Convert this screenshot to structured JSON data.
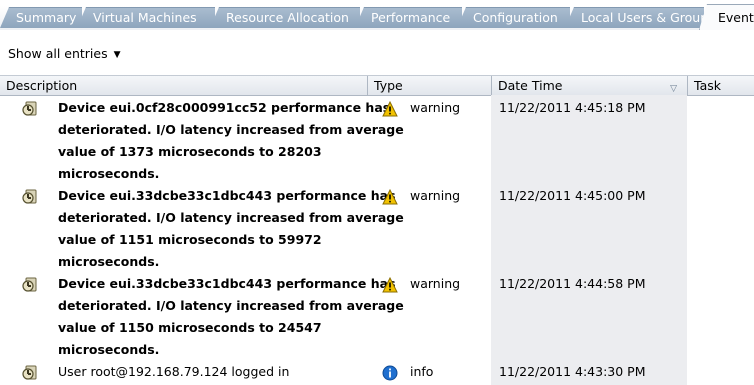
{
  "tabs": [
    {
      "label": "Summary"
    },
    {
      "label": "Virtual Machines"
    },
    {
      "label": "Resource Allocation"
    },
    {
      "label": "Performance"
    },
    {
      "label": "Configuration"
    },
    {
      "label": "Local Users & Groups"
    },
    {
      "label": "Events"
    }
  ],
  "filter": {
    "label": "Show all entries"
  },
  "columns": {
    "description": "Description",
    "type": "Type",
    "date_time": "Date Time",
    "task": "Task"
  },
  "events": [
    {
      "lines": [
        "Device eui.0cf28c000991cc52 performance has",
        "deteriorated. I/O latency increased from average",
        "value of 1373 microseconds to 28203",
        "microseconds."
      ],
      "type": "warning",
      "date": "11/22/2011 4:45:18 PM"
    },
    {
      "lines": [
        "Device eui.33dcbe33c1dbc443 performance has",
        "deteriorated. I/O latency increased from average",
        "value of 1151 microseconds to 59972",
        "microseconds."
      ],
      "type": "warning",
      "date": "11/22/2011 4:45:00 PM"
    },
    {
      "lines": [
        "Device eui.33dcbe33c1dbc443 performance has",
        "deteriorated. I/O latency increased from average",
        "value of 1150 microseconds to 24547",
        "microseconds."
      ],
      "type": "warning",
      "date": "11/22/2011 4:44:58 PM"
    },
    {
      "lines": [
        "User root@192.168.79.124 logged in"
      ],
      "type": "info",
      "date": "11/22/2011 4:43:30 PM"
    }
  ],
  "colors": {
    "tab_inactive": "#9cb1c6",
    "date_column_bg": "#ecedf0",
    "warning": "#f2c200",
    "info": "#1f6fcf"
  }
}
